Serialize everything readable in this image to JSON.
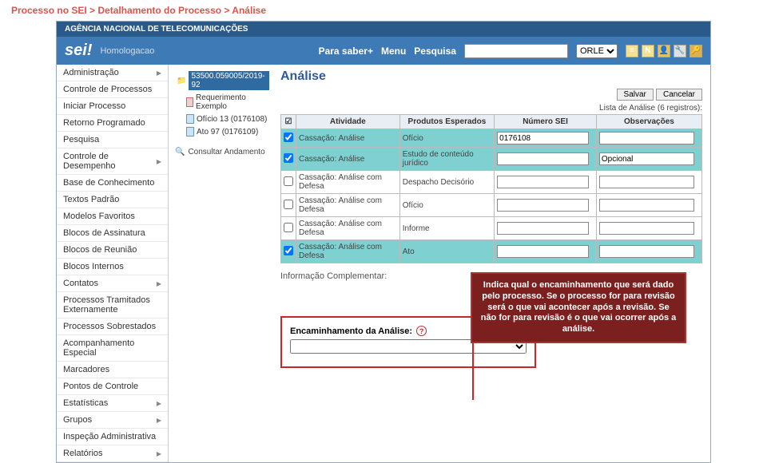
{
  "breadcrumb": "Processo no SEI > Detalhamento do Processo > Análise",
  "agency": "AGÊNCIA NACIONAL DE TELECOMUNICAÇÕES",
  "logo": "sei!",
  "env": "Homologacao",
  "topnav": {
    "parasaber": "Para saber+",
    "menu": "Menu",
    "pesquisa": "Pesquisa"
  },
  "unit": "ORLE",
  "sidebar": [
    {
      "label": "Administração",
      "sub": true
    },
    {
      "label": "Controle de Processos",
      "sub": false
    },
    {
      "label": "Iniciar Processo",
      "sub": false
    },
    {
      "label": "Retorno Programado",
      "sub": false
    },
    {
      "label": "Pesquisa",
      "sub": false
    },
    {
      "label": "Controle de Desempenho",
      "sub": true
    },
    {
      "label": "Base de Conhecimento",
      "sub": false
    },
    {
      "label": "Textos Padrão",
      "sub": false
    },
    {
      "label": "Modelos Favoritos",
      "sub": false
    },
    {
      "label": "Blocos de Assinatura",
      "sub": false
    },
    {
      "label": "Blocos de Reunião",
      "sub": false
    },
    {
      "label": "Blocos Internos",
      "sub": false
    },
    {
      "label": "Contatos",
      "sub": true
    },
    {
      "label": "Processos Tramitados Externamente",
      "sub": false
    },
    {
      "label": "Processos Sobrestados",
      "sub": false
    },
    {
      "label": "Acompanhamento Especial",
      "sub": false
    },
    {
      "label": "Marcadores",
      "sub": false
    },
    {
      "label": "Pontos de Controle",
      "sub": false
    },
    {
      "label": "Estatísticas",
      "sub": true
    },
    {
      "label": "Grupos",
      "sub": true
    },
    {
      "label": "Inspeção Administrativa",
      "sub": false
    },
    {
      "label": "Relatórios",
      "sub": true
    }
  ],
  "tree": {
    "root": "53500.059005/2019-92",
    "docs": [
      {
        "label": "Requerimento Exemplo",
        "type": "pdf"
      },
      {
        "label": "Ofício 13 (0176108)",
        "type": "doc"
      },
      {
        "label": "Ato 97 (0176109)",
        "type": "doc"
      }
    ],
    "consultar": "Consultar Andamento"
  },
  "main": {
    "title": "Análise",
    "buttons": {
      "salvar": "Salvar",
      "cancelar": "Cancelar"
    },
    "list_header": "Lista de Análise (6 registros):",
    "cols": {
      "chk": "☑",
      "atividade": "Atividade",
      "prod": "Produtos Esperados",
      "num": "Número SEI",
      "obs": "Observações"
    },
    "rows": [
      {
        "on": true,
        "atividade": "Cassação: Análise",
        "prod": "Ofício",
        "num": "0176108",
        "obs": ""
      },
      {
        "on": true,
        "atividade": "Cassação: Análise",
        "prod": "Estudo de conteúdo jurídico",
        "num": "",
        "obs": "Opcional"
      },
      {
        "on": false,
        "atividade": "Cassação: Análise com Defesa",
        "prod": "Despacho Decisório",
        "num": "",
        "obs": ""
      },
      {
        "on": false,
        "atividade": "Cassação: Análise com Defesa",
        "prod": "Ofício",
        "num": "",
        "obs": ""
      },
      {
        "on": false,
        "atividade": "Cassação: Análise com Defesa",
        "prod": "Informe",
        "num": "",
        "obs": ""
      },
      {
        "on": true,
        "atividade": "Cassação: Análise com Defesa",
        "prod": "Ato",
        "num": "",
        "obs": ""
      }
    ],
    "info_label": "Informação Complementar:",
    "enc_label": "Encaminhamento da Análise:"
  },
  "callout": "Indica qual o encaminhamento que será dado pelo processo. Se o processo for para revisão será o que vai acontecer após a revisão. Se não for para revisão é o que vai ocorrer após a análise."
}
